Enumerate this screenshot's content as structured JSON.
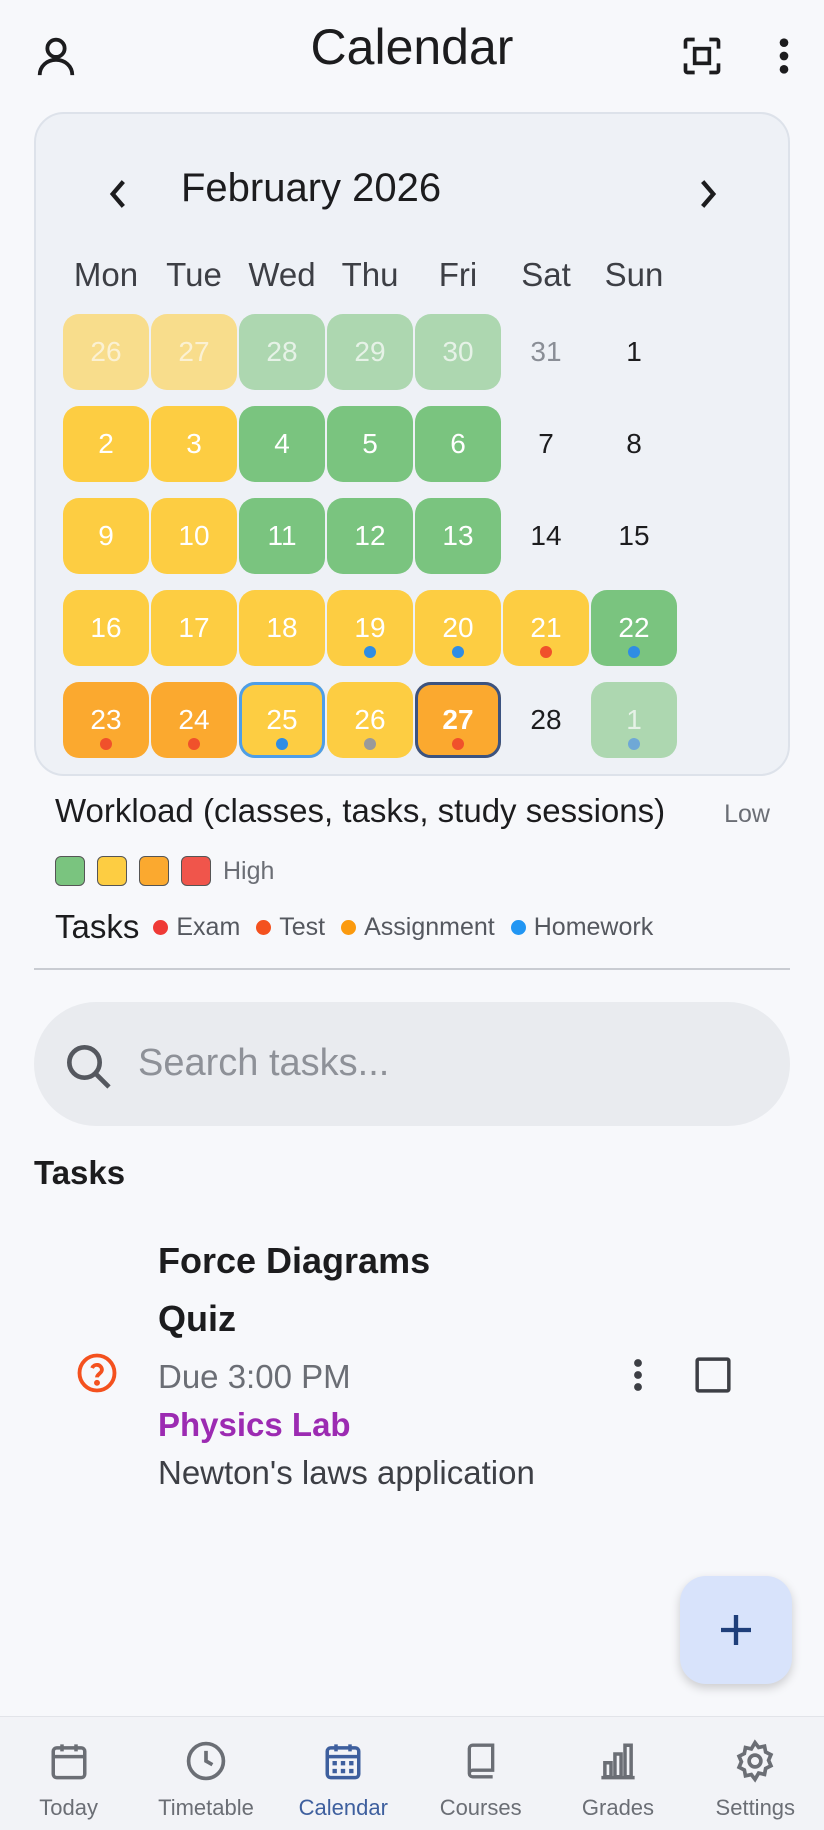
{
  "header": {
    "title": "Calendar",
    "profile_icon": "person-icon",
    "scan_icon": "fullscreen-frame-icon",
    "menu_icon": "more-vert-icon"
  },
  "calendar": {
    "month_label": "February 2026",
    "prev_icon": "chevron-left-icon",
    "next_icon": "chevron-right-icon",
    "weekdays": [
      "Mon",
      "Tue",
      "Wed",
      "Thu",
      "Fri",
      "Sat",
      "Sun"
    ],
    "days": [
      {
        "n": "26",
        "load": "yellow",
        "outside": true
      },
      {
        "n": "27",
        "load": "yellow",
        "outside": true
      },
      {
        "n": "28",
        "load": "green",
        "outside": true
      },
      {
        "n": "29",
        "load": "green",
        "outside": true
      },
      {
        "n": "30",
        "load": "green",
        "outside": true
      },
      {
        "n": "31",
        "load": "none",
        "outside": true
      },
      {
        "n": "1",
        "load": "none"
      },
      {
        "n": "2",
        "load": "yellow"
      },
      {
        "n": "3",
        "load": "yellow"
      },
      {
        "n": "4",
        "load": "green"
      },
      {
        "n": "5",
        "load": "green"
      },
      {
        "n": "6",
        "load": "green"
      },
      {
        "n": "7",
        "load": "none"
      },
      {
        "n": "8",
        "load": "none"
      },
      {
        "n": "9",
        "load": "yellow"
      },
      {
        "n": "10",
        "load": "yellow"
      },
      {
        "n": "11",
        "load": "green"
      },
      {
        "n": "12",
        "load": "green"
      },
      {
        "n": "13",
        "load": "green"
      },
      {
        "n": "14",
        "load": "none"
      },
      {
        "n": "15",
        "load": "none"
      },
      {
        "n": "16",
        "load": "yellow"
      },
      {
        "n": "17",
        "load": "yellow"
      },
      {
        "n": "18",
        "load": "yellow"
      },
      {
        "n": "19",
        "load": "yellow",
        "dot": "#2f8de4"
      },
      {
        "n": "20",
        "load": "yellow",
        "dot": "#2f8de4"
      },
      {
        "n": "21",
        "load": "yellow",
        "dot": "#f0512b"
      },
      {
        "n": "22",
        "load": "green",
        "dot": "#2f8de4"
      },
      {
        "n": "23",
        "load": "orange",
        "dot": "#f0512b"
      },
      {
        "n": "24",
        "load": "orange",
        "dot": "#f0512b"
      },
      {
        "n": "25",
        "load": "yellow",
        "dot": "#2f8de4",
        "selected": true
      },
      {
        "n": "26",
        "load": "yellow",
        "dot": "#9a9a9a"
      },
      {
        "n": "27",
        "load": "orange",
        "dot": "#f0512b",
        "today": true
      },
      {
        "n": "28",
        "load": "none"
      },
      {
        "n": "1",
        "load": "green",
        "outside": true,
        "dot": "#6fa8d6"
      }
    ]
  },
  "legend": {
    "workload_label": "Workload (classes, tasks, study sessions)",
    "low_label": "Low",
    "high_label": "High",
    "swatches": [
      "#7ac47f",
      "#fdcd42",
      "#fba92f",
      "#f0554b"
    ],
    "tasks_label": "Tasks",
    "task_types": [
      {
        "label": "Exam",
        "color": "#ef3a36"
      },
      {
        "label": "Test",
        "color": "#f4511e"
      },
      {
        "label": "Assignment",
        "color": "#fb9a0e"
      },
      {
        "label": "Homework",
        "color": "#2196f3"
      }
    ]
  },
  "search": {
    "placeholder": "Search tasks...",
    "value": ""
  },
  "tasks_section": {
    "title": "Tasks",
    "items": [
      {
        "title": "Force Diagrams Quiz",
        "due": "Due 3:00 PM",
        "course": "Physics Lab",
        "description": "Newton's laws application",
        "type_icon": "quiz-help-icon"
      }
    ]
  },
  "fab": {
    "icon": "plus-icon"
  },
  "bottom_nav": [
    {
      "label": "Today",
      "icon": "calendar-today-icon",
      "active": false
    },
    {
      "label": "Timetable",
      "icon": "clock-icon",
      "active": false
    },
    {
      "label": "Calendar",
      "icon": "calendar-month-icon",
      "active": true
    },
    {
      "label": "Courses",
      "icon": "book-icon",
      "active": false
    },
    {
      "label": "Grades",
      "icon": "bar-chart-icon",
      "active": false
    },
    {
      "label": "Settings",
      "icon": "gear-icon",
      "active": false
    }
  ]
}
